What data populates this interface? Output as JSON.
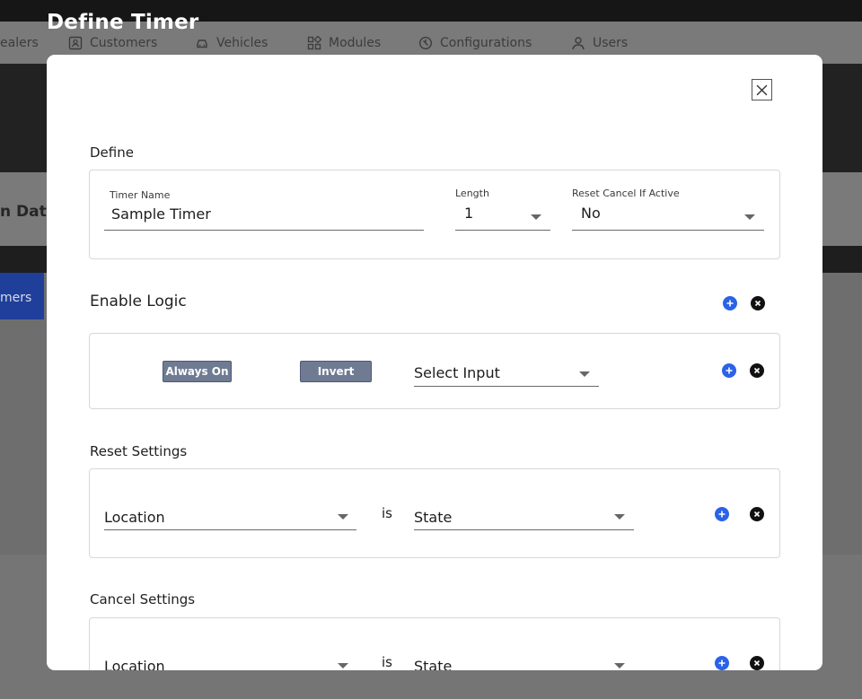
{
  "background": {
    "nav_items": [
      {
        "label": "ealers",
        "icon": "none"
      },
      {
        "label": "Customers",
        "icon": "id-card-icon"
      },
      {
        "label": "Vehicles",
        "icon": "car-icon"
      },
      {
        "label": "Modules",
        "icon": "grid-icon"
      },
      {
        "label": "Configurations",
        "icon": "configuration-icon"
      },
      {
        "label": "Users",
        "icon": "user-icon"
      }
    ],
    "partial_heading": "n Date",
    "partial_tab": "mers"
  },
  "dialog": {
    "title": "Define Timer",
    "define": {
      "section_title": "Define",
      "timer_name_label": "Timer Name",
      "timer_name_value": "Sample Timer",
      "length_label": "Length",
      "length_value": "1",
      "reset_cancel_label": "Reset Cancel If Active",
      "reset_cancel_value": "No"
    },
    "enable_logic": {
      "section_title": "Enable Logic",
      "always_on_label": "Always On",
      "invert_label": "Invert",
      "select_input_placeholder": "Select Input"
    },
    "reset_settings": {
      "section_title": "Reset Settings",
      "location_placeholder": "Location",
      "is_text": "is",
      "state_placeholder": "State"
    },
    "cancel_settings": {
      "section_title": "Cancel Settings",
      "location_placeholder": "Location",
      "is_text": "is",
      "state_placeholder": "State"
    }
  },
  "colors": {
    "accent_blue": "#2a62e8",
    "chip_grey": "#6f7b93"
  }
}
